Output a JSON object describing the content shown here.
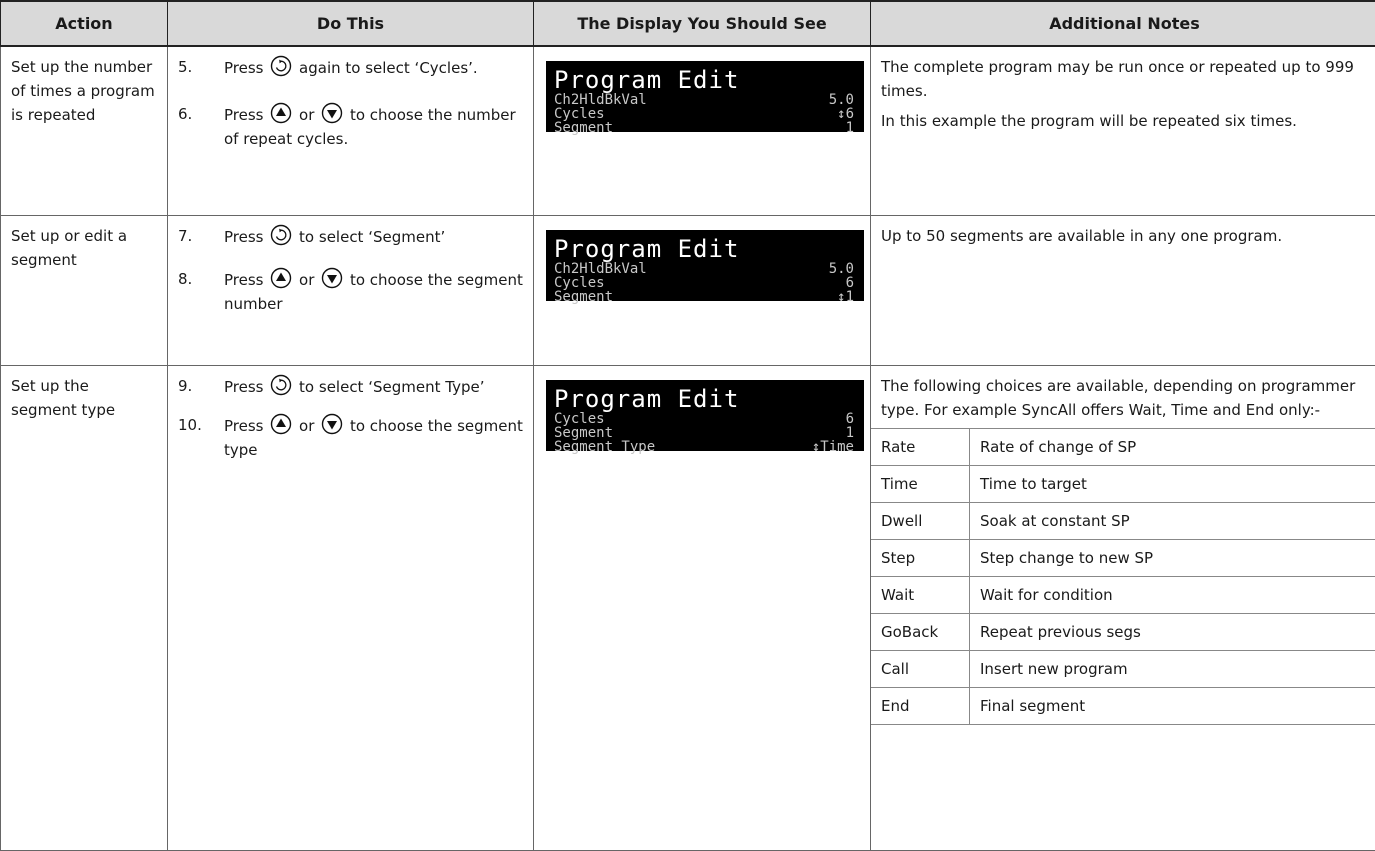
{
  "headers": {
    "action": "Action",
    "do_this": "Do This",
    "display": "The Display You Should See",
    "notes": "Additional Notes"
  },
  "rows": [
    {
      "action": "Set up the number of times a program is repeated",
      "steps": [
        {
          "num": "5.",
          "pre": "Press",
          "icon": "scroll-icon",
          "mid": "",
          "icon2": "",
          "post": "again to select ‘Cycles’."
        },
        {
          "num": "6.",
          "pre": "Press",
          "icon": "raise-icon",
          "mid": "or",
          "icon2": "lower-icon",
          "post": "to choose the number of repeat cycles."
        }
      ],
      "lcd": {
        "header": "Program Edit",
        "lines": [
          {
            "label": "Ch2HldBkVal",
            "value": "5.0"
          },
          {
            "label": "Cycles",
            "value": "↕6"
          },
          {
            "label": "Segment",
            "value": "1"
          }
        ]
      },
      "notes": [
        "The complete program may be run once or repeated up to 999 times.",
        "In this example the program will be repeated six times."
      ]
    },
    {
      "action": "Set up or edit a segment",
      "steps": [
        {
          "num": "7.",
          "pre": "Press",
          "icon": "scroll-icon",
          "mid": "",
          "icon2": "",
          "post": "to select ‘Segment’"
        },
        {
          "num": "8.",
          "pre": "Press",
          "icon": "raise-icon",
          "mid": "or",
          "icon2": "lower-icon",
          "post": "to choose the segment number"
        }
      ],
      "lcd": {
        "header": "Program Edit",
        "lines": [
          {
            "label": "Ch2HldBkVal",
            "value": "5.0"
          },
          {
            "label": "Cycles",
            "value": "6"
          },
          {
            "label": "Segment",
            "value": "↕1"
          }
        ]
      },
      "notes": [
        "Up to 50 segments are available in any one program."
      ]
    },
    {
      "action": "Set up the segment type",
      "steps": [
        {
          "num": "9.",
          "pre": "Press",
          "icon": "scroll-icon",
          "mid": "",
          "icon2": "",
          "post": "to select ‘Segment Type’"
        },
        {
          "num": "10.",
          "pre": "Press",
          "icon": "raise-icon",
          "mid": "or",
          "icon2": "lower-icon",
          "post": "to choose the segment type"
        }
      ],
      "lcd": {
        "header": "Program Edit",
        "lines": [
          {
            "label": "Cycles",
            "value": "6"
          },
          {
            "label": "Segment",
            "value": "1"
          },
          {
            "label": "Segment Type",
            "value": "↕Time"
          }
        ]
      },
      "notes": [
        "The following choices are available, depending on programmer type.  For example SyncAll offers Wait, Time and End only:-"
      ],
      "choices": [
        {
          "type": "Rate",
          "desc": "Rate of change of SP"
        },
        {
          "type": "Time",
          "desc": "Time to target"
        },
        {
          "type": "Dwell",
          "desc": "Soak at constant SP"
        },
        {
          "type": "Step",
          "desc": "Step change to new SP"
        },
        {
          "type": "Wait",
          "desc": "Wait for condition"
        },
        {
          "type": "GoBack",
          "desc": "Repeat previous segs"
        },
        {
          "type": "Call",
          "desc": "Insert new program"
        },
        {
          "type": "End",
          "desc": "Final segment"
        }
      ]
    }
  ]
}
